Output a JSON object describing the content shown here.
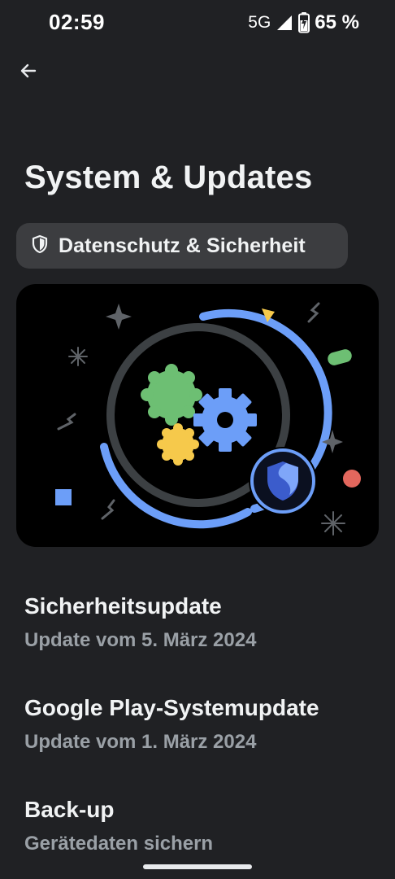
{
  "status_bar": {
    "time": "02:59",
    "network": "5G",
    "battery": "65 %",
    "icons": [
      "signal-icon",
      "battery-charging-icon"
    ]
  },
  "header": {
    "back_icon": "arrow-left-icon",
    "title": "System & Updates"
  },
  "chip": {
    "icon": "shield-outline-icon",
    "label": "Datenschutz & Sicherheit"
  },
  "illustration": {
    "name": "system-updates-illustration",
    "colors": {
      "green": "#6dbf73",
      "yellow": "#f6c94b",
      "blue": "#6c9ef8",
      "red": "#e3675d",
      "ring": "#3c4043",
      "shield_dark": "#3b5ccc",
      "shield_light": "#7fa6f9"
    }
  },
  "items": [
    {
      "title": "Sicherheitsupdate",
      "subtitle": "Update vom 5. März 2024"
    },
    {
      "title": "Google Play-Systemupdate",
      "subtitle": "Update vom 1. März 2024"
    },
    {
      "title": "Back-up",
      "subtitle": "Gerätedaten sichern"
    }
  ],
  "theme": {
    "background": "#202124",
    "chip_bg": "#3c3d40",
    "text": "#f1f3f4",
    "subtext": "#9aa0a6"
  }
}
